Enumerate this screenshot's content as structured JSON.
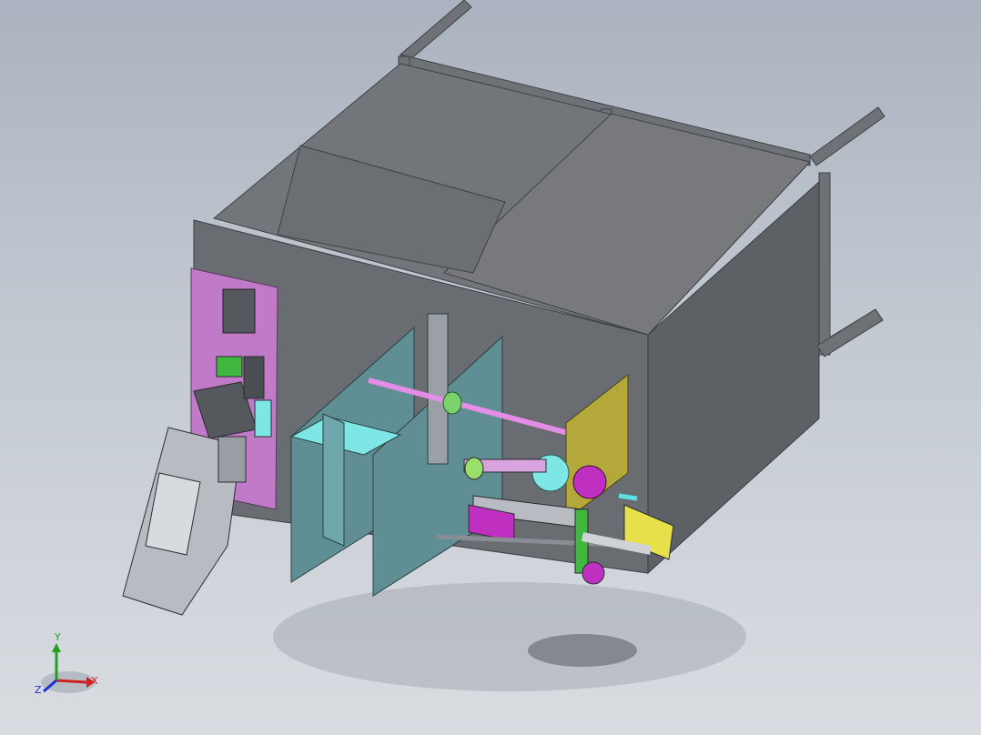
{
  "viewport": {
    "background_top": "#aab3bf",
    "background_bottom": "#d9dde2"
  },
  "triad": {
    "x_label": "X",
    "y_label": "Y",
    "z_label": "Z",
    "x_color": "#d02020",
    "y_color": "#20a020",
    "z_color": "#2030d0"
  },
  "model": {
    "frame_color": "#6e7176",
    "panel_color": "#6a6d72",
    "pink_plate_color": "#c07ac8",
    "teal_plate_color": "#5f8f94",
    "cyan_part_color": "#7fe6e6",
    "yellow_plate_color": "#b4a83a",
    "green_part_color": "#40b840",
    "magenta_part_color": "#c030c0",
    "silver_part_color": "#b8bcc2"
  }
}
